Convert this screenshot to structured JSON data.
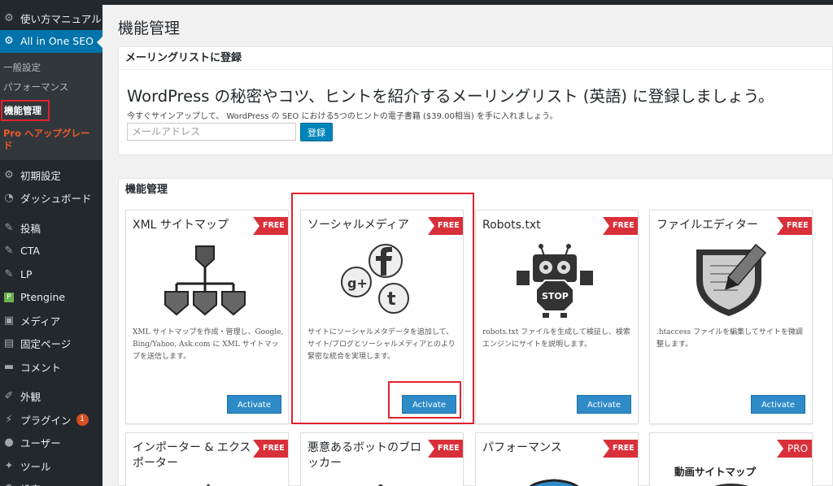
{
  "sidebar": {
    "top_items": [
      {
        "label": "使い方マニュアル",
        "icon": "gear-icon"
      },
      {
        "label": "All in One SEO",
        "icon": "gear-icon"
      }
    ],
    "submenu": {
      "general": "一般設定",
      "performance": "パフォーマンス",
      "features": "機能管理",
      "pro": "Pro へアップグレード"
    },
    "items": [
      {
        "label": "初期設定",
        "icon": "gear-icon"
      },
      {
        "label": "ダッシュボード",
        "icon": "dashboard-icon"
      },
      {
        "label": "投稿",
        "icon": "pin-icon"
      },
      {
        "label": "CTA",
        "icon": "pin-icon"
      },
      {
        "label": "LP",
        "icon": "pin-icon"
      },
      {
        "label": "Ptengine",
        "icon": "ptengine-icon"
      },
      {
        "label": "メディア",
        "icon": "media-icon"
      },
      {
        "label": "固定ページ",
        "icon": "page-icon"
      },
      {
        "label": "コメント",
        "icon": "comment-icon"
      },
      {
        "label": "外観",
        "icon": "brush-icon"
      },
      {
        "label": "プラグイン",
        "icon": "plugin-icon",
        "badge": "1"
      },
      {
        "label": "ユーザー",
        "icon": "user-icon"
      },
      {
        "label": "ツール",
        "icon": "wrench-icon"
      },
      {
        "label": "設定",
        "icon": "settings-icon"
      }
    ]
  },
  "page": {
    "title": "機能管理"
  },
  "mailing": {
    "heading": "メーリングリストに登録",
    "headline": "WordPress の秘密やコツ、ヒントを紹介するメーリングリスト (英語) に登録しましょう。",
    "subtext": "今すぐサインアップして、 WordPress の SEO における5つのヒントの電子書籍 ($39.00相当) を手に入れましょう。",
    "email_placeholder": "メールアドレス",
    "submit_label": "登録"
  },
  "features": {
    "heading": "機能管理",
    "cards": [
      {
        "title": "XML サイトマップ",
        "ribbon": "FREE",
        "icon": "sitemap-icon",
        "desc": "XML サイトマップを作成・管理し、Google, Bing/Yahoo, Ask.com に XML サイトマップを送信します。",
        "button": "Activate"
      },
      {
        "title": "ソーシャルメディア",
        "ribbon": "FREE",
        "icon": "social-media-icon",
        "desc": "サイトにソーシャルメタデータを追加して、サイト/ブログとソーシャルメディアとのより緊密な統合を実現します。",
        "button": "Activate"
      },
      {
        "title": "Robots.txt",
        "ribbon": "FREE",
        "icon": "robot-stop-icon",
        "desc": "robots.txt ファイルを生成して検証し、検索エンジンにサイトを説明します。",
        "button": "Activate"
      },
      {
        "title": "ファイルエディター",
        "ribbon": "FREE",
        "icon": "file-editor-icon",
        "desc": ".htaccess ファイルを編集してサイトを微調整します。",
        "button": "Activate"
      },
      {
        "title": "インポーター & エクスポーター",
        "ribbon": "FREE",
        "icon": "importer-icon"
      },
      {
        "title": "悪意あるボットのブロッカー",
        "ribbon": "FREE",
        "icon": "bot-blocker-icon"
      },
      {
        "title": "パフォーマンス",
        "ribbon": "FREE",
        "icon": "performance-icon"
      },
      {
        "title": "",
        "ribbon": "PRO",
        "icon": "video-sitemap-icon",
        "inner_label": "動画サイトマップ"
      }
    ]
  },
  "colors": {
    "sidebar_bg": "#23282d",
    "active_blue": "#0073aa",
    "ribbon_red": "#d8303a",
    "button_blue": "#2e8bc7",
    "highlight_red": "#e0222e"
  }
}
